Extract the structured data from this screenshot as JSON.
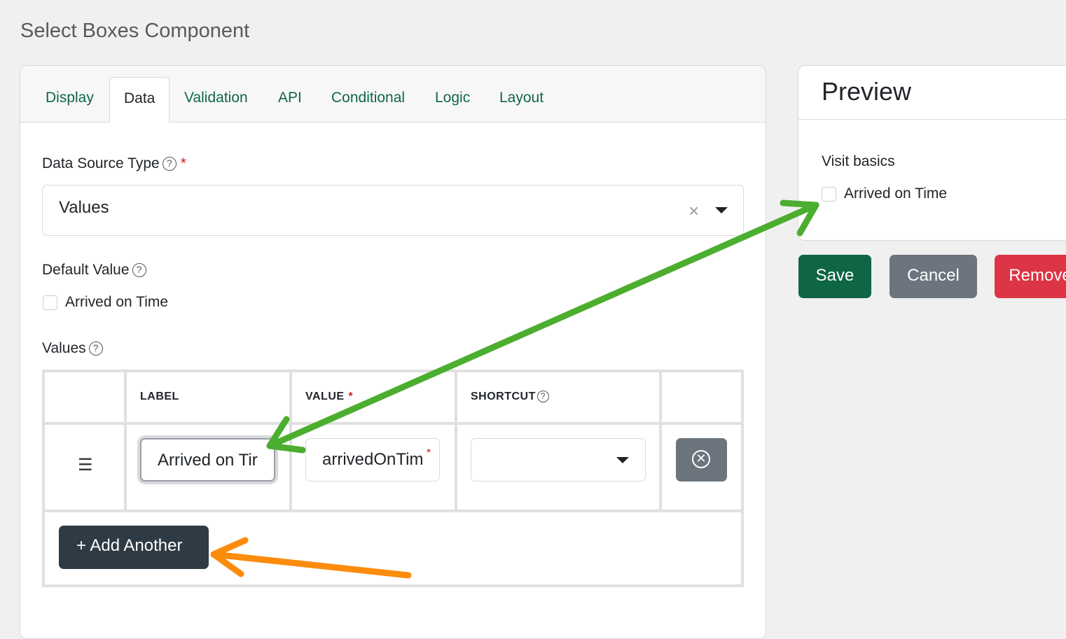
{
  "page": {
    "title": "Select Boxes Component"
  },
  "tabs": [
    {
      "label": "Display"
    },
    {
      "label": "Data",
      "active": true
    },
    {
      "label": "Validation"
    },
    {
      "label": "API"
    },
    {
      "label": "Conditional"
    },
    {
      "label": "Logic"
    },
    {
      "label": "Layout"
    }
  ],
  "data_source": {
    "label": "Data Source Type",
    "required_mark": "*",
    "value": "Values",
    "clear_glyph": "×"
  },
  "default_value": {
    "label": "Default Value",
    "option_label": "Arrived on Time",
    "checked": false
  },
  "values": {
    "label": "Values",
    "columns": {
      "label": "LABEL",
      "value": "VALUE",
      "shortcut": "SHORTCUT"
    },
    "rows": [
      {
        "label": "Arrived on Tir",
        "value": "arrivedOnTim",
        "shortcut": ""
      }
    ],
    "drag_glyph": "☰",
    "add_button": "+ Add Another"
  },
  "preview": {
    "title": "Preview",
    "field_label": "Visit basics",
    "option_label": "Arrived on Time",
    "checked": false
  },
  "actions": {
    "save": "Save",
    "cancel": "Cancel",
    "remove": "Remove"
  },
  "help_glyph": "?",
  "icons": {
    "help": "question-circle-icon",
    "clear": "close-icon",
    "caret": "caret-down-icon",
    "drag": "drag-handle-icon",
    "remove": "remove-circle-icon",
    "add": "plus-icon"
  },
  "colors": {
    "accent": "#106646",
    "save": "#0e6645",
    "cancel": "#6c757d",
    "remove": "#dc3545",
    "add": "#2f3b44",
    "required": "#d01c26",
    "arrow_green": "#4cae2f",
    "arrow_orange": "#fb8c0c"
  }
}
